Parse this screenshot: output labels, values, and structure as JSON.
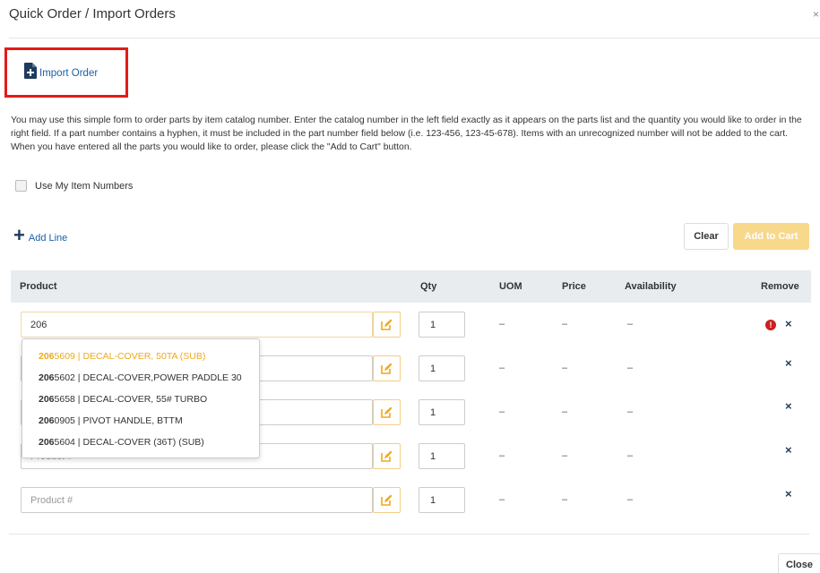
{
  "modal": {
    "title": "Quick Order / Import Orders",
    "close_icon": "×"
  },
  "import": {
    "label": "Import Order",
    "icon": "file-plus-icon"
  },
  "instructions": "You may use this simple form to order parts by item catalog number. Enter the catalog number in the left field exactly as it appears on the parts list and the quantity you would like to order in the right field. If a part number contains a hyphen, it must be included in the part number field below (i.e. 123-456, 123-45-678). Items with an unrecognized number will not be added to the cart. When you have entered all the parts you would like to order, please click the \"Add to Cart\" button.",
  "options": {
    "use_my_item_numbers": "Use My Item Numbers"
  },
  "toolbar": {
    "add_line": "Add Line",
    "clear": "Clear",
    "add_to_cart": "Add to Cart"
  },
  "table": {
    "headers": {
      "product": "Product",
      "qty": "Qty",
      "uom": "UOM",
      "price": "Price",
      "availability": "Availability",
      "remove": "Remove"
    },
    "rows": [
      {
        "product_value": "206",
        "placeholder": "",
        "qty": "1",
        "uom": "–",
        "price": "–",
        "availability": "–"
      },
      {
        "product_value": "",
        "placeholder": "Product #",
        "qty": "1",
        "uom": "–",
        "price": "–",
        "availability": "–"
      },
      {
        "product_value": "",
        "placeholder": "Product #",
        "qty": "1",
        "uom": "–",
        "price": "–",
        "availability": "–"
      },
      {
        "product_value": "",
        "placeholder": "Product #",
        "qty": "1",
        "uom": "–",
        "price": "–",
        "availability": "–"
      },
      {
        "product_value": "",
        "placeholder": "Product #",
        "qty": "1",
        "uom": "–",
        "price": "–",
        "availability": "–"
      }
    ],
    "remove_icon": "×",
    "warning_icon": "!"
  },
  "suggestions": [
    {
      "match": "206",
      "rest": "5609 | DECAL-COVER, 50TA (SUB)"
    },
    {
      "match": "206",
      "rest": "5602 | DECAL-COVER,POWER PADDLE 30"
    },
    {
      "match": "206",
      "rest": "5658 | DECAL-COVER, 55# TURBO"
    },
    {
      "match": "206",
      "rest": "0905 | PIVOT HANDLE, BTTM"
    },
    {
      "match": "206",
      "rest": "5604 | DECAL-COVER (36T) (SUB)"
    }
  ],
  "footer": {
    "close": "Close"
  },
  "colors": {
    "accent_link": "#1b5fa8",
    "highlight_border": "#e31b17",
    "add_to_cart_bg": "#f8d88a",
    "suggestion_highlight": "#f0a81c",
    "warning": "#cc1f1f"
  }
}
